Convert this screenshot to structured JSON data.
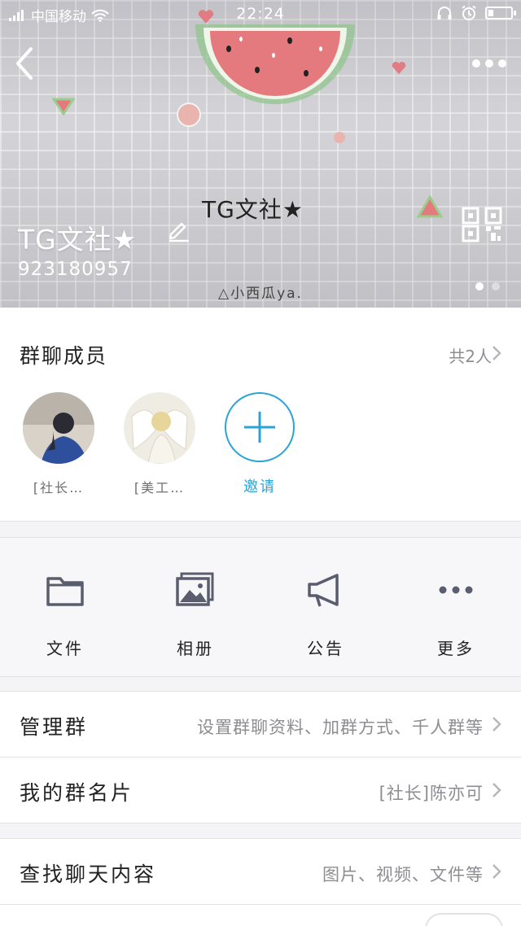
{
  "status_bar": {
    "carrier": "中国移动",
    "time": "22:24"
  },
  "cover": {
    "image_title": "TG文社★",
    "image_signature": "△小西瓜ya.",
    "group_name": "TG文社★",
    "group_id": "923180957"
  },
  "members": {
    "title": "群聊成员",
    "count": "共2人",
    "list": [
      {
        "name": "[社长…"
      },
      {
        "name": "[美工…"
      }
    ],
    "invite_label": "邀请"
  },
  "features": [
    {
      "label": "文件",
      "icon": "folder-icon"
    },
    {
      "label": "相册",
      "icon": "album-icon"
    },
    {
      "label": "公告",
      "icon": "megaphone-icon"
    },
    {
      "label": "更多",
      "icon": "more-dots-icon"
    }
  ],
  "rows": {
    "manage": {
      "title": "管理群",
      "value": "设置群聊资料、加群方式、千人群等"
    },
    "card": {
      "title": "我的群名片",
      "value": "[社长]陈亦可"
    },
    "search": {
      "title": "查找聊天内容",
      "value": "图片、视频、文件等"
    }
  },
  "colors": {
    "accent": "#2aa3d6",
    "icon_gray": "#5a5d6e",
    "secondary_text": "#8d8d92"
  }
}
